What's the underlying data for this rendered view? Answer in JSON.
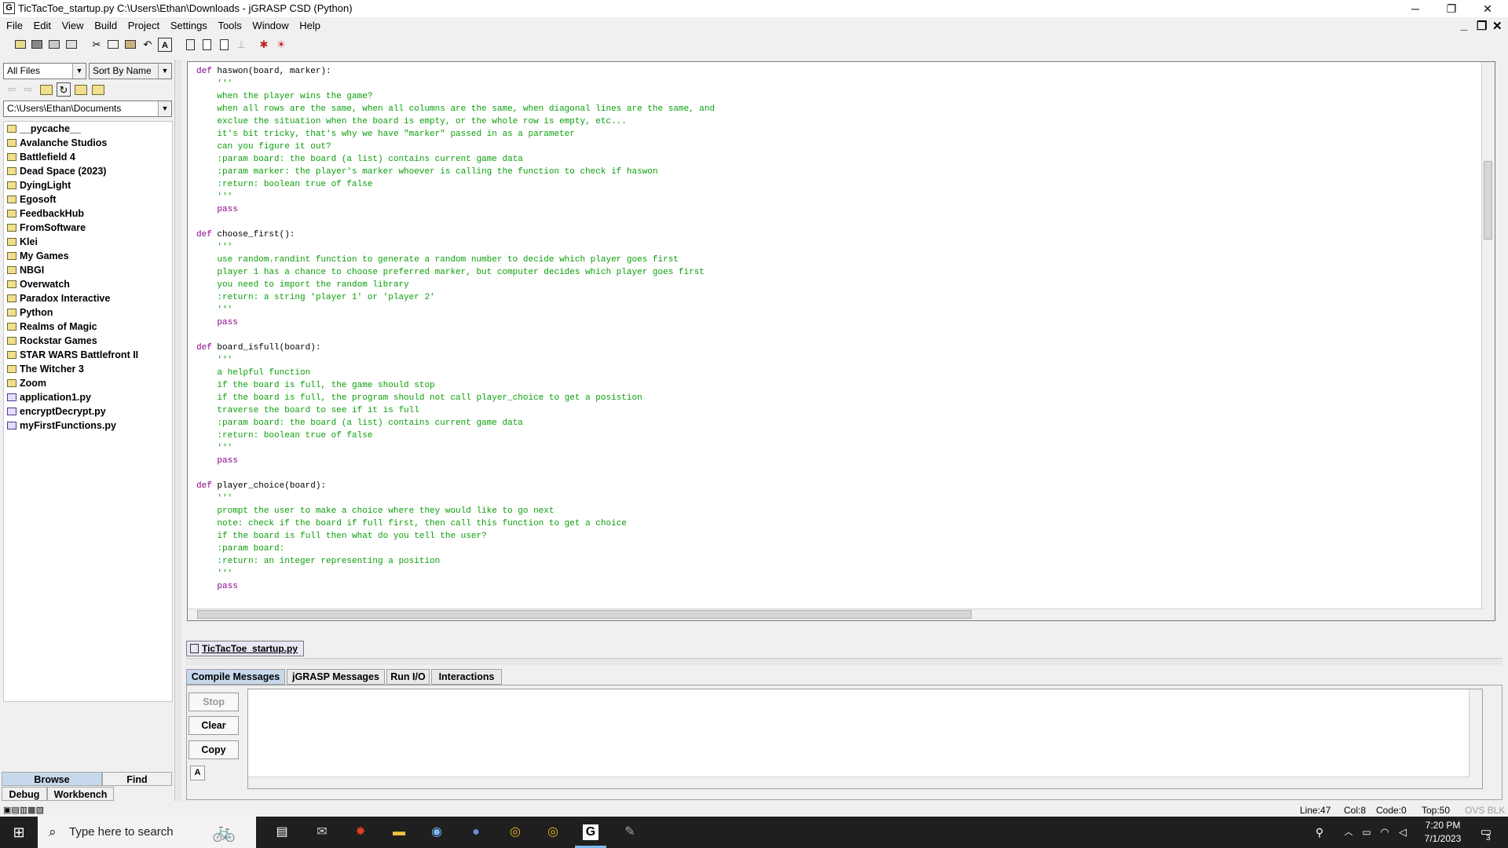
{
  "window": {
    "title": "TicTacToe_startup.py  C:\\Users\\Ethan\\Downloads - jGRASP CSD (Python)",
    "app_icon_letter": "G",
    "minimize": "─",
    "maximize": "❐",
    "close": "✕"
  },
  "menu": {
    "items": [
      "File",
      "Edit",
      "View",
      "Build",
      "Project",
      "Settings",
      "Tools",
      "Window",
      "Help"
    ],
    "mdi_minimize": "_",
    "mdi_restore": "❐",
    "mdi_close": "✕"
  },
  "toolbar": {
    "icons": [
      "open-icon",
      "save-icon",
      "save-all-icon",
      "print-icon",
      "cut-icon",
      "copy-icon",
      "paste-icon",
      "undo-icon",
      "font-icon",
      "csd-icon",
      "page-icon",
      "page-icon-2",
      "pin-icon",
      "debug-icon",
      "bug-icon"
    ],
    "font_letter": "A"
  },
  "browser": {
    "filter": "All Files",
    "sort": "Sort By Name",
    "path": "C:\\Users\\Ethan\\Documents",
    "items": [
      {
        "name": "__pycache__",
        "type": "folder"
      },
      {
        "name": "Avalanche Studios",
        "type": "folder"
      },
      {
        "name": "Battlefield 4",
        "type": "folder"
      },
      {
        "name": "Dead Space (2023)",
        "type": "folder"
      },
      {
        "name": "DyingLight",
        "type": "folder"
      },
      {
        "name": "Egosoft",
        "type": "folder"
      },
      {
        "name": "FeedbackHub",
        "type": "folder"
      },
      {
        "name": "FromSoftware",
        "type": "folder"
      },
      {
        "name": "Klei",
        "type": "folder"
      },
      {
        "name": "My Games",
        "type": "folder"
      },
      {
        "name": "NBGI",
        "type": "folder"
      },
      {
        "name": "Overwatch",
        "type": "folder"
      },
      {
        "name": "Paradox Interactive",
        "type": "folder"
      },
      {
        "name": "Python",
        "type": "folder"
      },
      {
        "name": "Realms of Magic",
        "type": "folder"
      },
      {
        "name": "Rockstar Games",
        "type": "folder"
      },
      {
        "name": "STAR WARS Battlefront II",
        "type": "folder"
      },
      {
        "name": "The Witcher 3",
        "type": "folder"
      },
      {
        "name": "Zoom",
        "type": "folder"
      },
      {
        "name": "application1.py",
        "type": "py"
      },
      {
        "name": "encryptDecrypt.py",
        "type": "py"
      },
      {
        "name": "myFirstFunctions.py",
        "type": "py"
      }
    ],
    "tabs": {
      "browse": "Browse",
      "find": "Find",
      "debug": "Debug",
      "workbench": "Workbench"
    }
  },
  "editor": {
    "lines": [
      {
        "type": "def",
        "kw": "def",
        "text": "haswon(board, marker):"
      },
      {
        "type": "doc",
        "text": "    '''"
      },
      {
        "type": "doc",
        "text": "    when the player wins the game?"
      },
      {
        "type": "doc",
        "text": "    when all rows are the same, when all columns are the same, when diagonal lines are the same, and"
      },
      {
        "type": "doc",
        "text": "    exclue the situation when the board is empty, or the whole row is empty, etc..."
      },
      {
        "type": "doc",
        "text": "    it's bit tricky, that's why we have \"marker\" passed in as a parameter"
      },
      {
        "type": "doc",
        "text": "    can you figure it out?"
      },
      {
        "type": "doc",
        "text": "    :param board: the board (a list) contains current game data"
      },
      {
        "type": "doc",
        "text": "    :param marker: the player's marker whoever is calling the function to check if haswon"
      },
      {
        "type": "doc",
        "text": "    :return: boolean true of false"
      },
      {
        "type": "doc",
        "text": "    '''"
      },
      {
        "type": "kw",
        "text": "    pass"
      },
      {
        "type": "blank",
        "text": ""
      },
      {
        "type": "def",
        "kw": "def",
        "text": "choose_first():"
      },
      {
        "type": "doc",
        "text": "    '''"
      },
      {
        "type": "doc",
        "text": "    use random.randint function to generate a random number to decide which player goes first"
      },
      {
        "type": "doc",
        "text": "    player 1 has a chance to choose preferred marker, but computer decides which player goes first"
      },
      {
        "type": "doc",
        "text": "    you need to import the random library"
      },
      {
        "type": "doc",
        "text": "    :return: a string 'player 1' or 'player 2'"
      },
      {
        "type": "doc",
        "text": "    '''"
      },
      {
        "type": "kw",
        "text": "    pass"
      },
      {
        "type": "blank",
        "text": ""
      },
      {
        "type": "def",
        "kw": "def",
        "text": "board_isfull(board):"
      },
      {
        "type": "doc",
        "text": "    '''"
      },
      {
        "type": "doc",
        "text": "    a helpful function"
      },
      {
        "type": "doc",
        "text": "    if the board is full, the game should stop"
      },
      {
        "type": "doc",
        "text": "    if the board is full, the program should not call player_choice to get a posistion"
      },
      {
        "type": "doc",
        "text": "    traverse the board to see if it is full"
      },
      {
        "type": "doc",
        "text": "    :param board: the board (a list) contains current game data"
      },
      {
        "type": "doc",
        "text": "    :return: boolean true of false"
      },
      {
        "type": "doc",
        "text": "    '''"
      },
      {
        "type": "kw",
        "text": "    pass"
      },
      {
        "type": "blank",
        "text": ""
      },
      {
        "type": "def",
        "kw": "def",
        "text": "player_choice(board):"
      },
      {
        "type": "doc",
        "text": "    '''"
      },
      {
        "type": "doc",
        "text": "    prompt the user to make a choice where they would like to go next"
      },
      {
        "type": "doc",
        "text": "    note: check if the board if full first, then call this function to get a choice"
      },
      {
        "type": "doc",
        "text": "    if the board is full then what do you tell the user?"
      },
      {
        "type": "doc",
        "text": "    :param board:"
      },
      {
        "type": "doc",
        "text": "    :return: an integer representing a position"
      },
      {
        "type": "doc",
        "text": "    '''"
      },
      {
        "type": "kw",
        "text": "    pass"
      }
    ],
    "file_tab": "TicTacToe_startup.py"
  },
  "messages": {
    "tabs": [
      "Compile Messages",
      "jGRASP Messages",
      "Run I/O",
      "Interactions"
    ],
    "active_tab": 0,
    "buttons": {
      "stop": "Stop",
      "clear": "Clear",
      "copy": "Copy",
      "font": "A"
    }
  },
  "status": {
    "line": "Line:47",
    "col": "Col:8",
    "code": "Code:0",
    "top": "Top:50",
    "mode": "OVS BLK"
  },
  "taskbar": {
    "search_placeholder": "Type here to search",
    "time": "7:20 PM",
    "date": "7/1/2023",
    "notification_count": "3",
    "apps": [
      "task-view-icon",
      "mail-icon",
      "red-app-icon",
      "file-explorer-icon",
      "steam-icon",
      "discord-icon",
      "chrome-icon",
      "chrome-icon-2",
      "jgrasp-icon",
      "paint-icon"
    ]
  },
  "colors": {
    "keyword": "#8b008b",
    "docstring": "#0a9f0a",
    "taskbar": "#1f1f1f"
  }
}
